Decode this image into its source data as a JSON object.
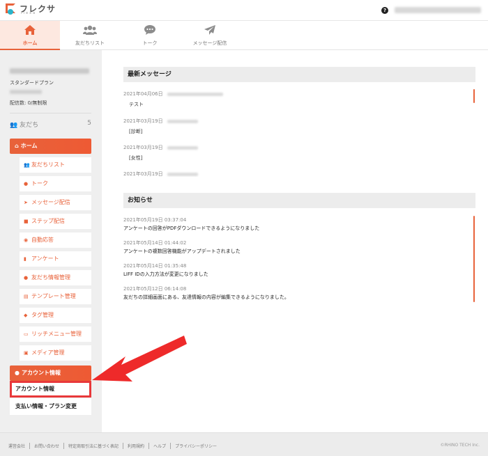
{
  "header": {
    "logo_text": "フレクサ",
    "logo_sub": "flexa",
    "help_icon": "?"
  },
  "nav": {
    "tabs": [
      {
        "label": "ホーム",
        "icon": "home-icon",
        "active": true
      },
      {
        "label": "友だちリスト",
        "icon": "users-icon",
        "active": false
      },
      {
        "label": "トーク",
        "icon": "chat-icon",
        "active": false
      },
      {
        "label": "メッセージ配信",
        "icon": "paper-plane-icon",
        "active": false
      }
    ]
  },
  "sidebar": {
    "plan": "スタンダードプラン",
    "delivery_count": "配信数: 0/無制限",
    "friends_label": "友だち",
    "friends_count": "5",
    "home_label": "ホーム",
    "items": [
      {
        "label": "友だちリスト",
        "icon": "users-icon"
      },
      {
        "label": "トーク",
        "icon": "chat-icon"
      },
      {
        "label": "メッセージ配信",
        "icon": "paper-plane-icon"
      },
      {
        "label": "ステップ配信",
        "icon": "book-icon"
      },
      {
        "label": "自動応答",
        "icon": "robot-icon"
      },
      {
        "label": "アンケート",
        "icon": "file-icon"
      },
      {
        "label": "友だち情報管理",
        "icon": "user-icon"
      },
      {
        "label": "テンプレート管理",
        "icon": "clipboard-icon"
      },
      {
        "label": "タグ管理",
        "icon": "tag-icon"
      },
      {
        "label": "リッチメニュー管理",
        "icon": "image-icon"
      },
      {
        "label": "メディア管理",
        "icon": "images-icon"
      }
    ],
    "account_head": "アカウント情報",
    "account_info": "アカウント情報",
    "billing": "支払い情報・プラン変更"
  },
  "latest_messages": {
    "title": "最新メッセージ",
    "items": [
      {
        "date": "2021年04月06日",
        "text": "テスト"
      },
      {
        "date": "2021年03月19日",
        "text": "[診断]"
      },
      {
        "date": "2021年03月19日",
        "text": "[女性]"
      },
      {
        "date": "2021年03月19日",
        "text": ""
      }
    ]
  },
  "news": {
    "title": "お知らせ",
    "items": [
      {
        "date": "2021年05月19日 03:37:04",
        "text": "アンケートの回答がPDFダウンロードできるようになりました"
      },
      {
        "date": "2021年05月14日 01:44:02",
        "text": "アンケートの複数回答機能がアップデートされました"
      },
      {
        "date": "2021年05月14日 01:35:48",
        "text": "LIFF IDの入力方法が変更になりました"
      },
      {
        "date": "2021年05月12日 06:14:08",
        "text": "友だちの詳細画面にある、友達情報の内容が編集できるようになりました。"
      }
    ]
  },
  "footer": {
    "links": [
      "運営会社",
      "お問い合わせ",
      "特定商取引法に基づく表記",
      "利用規約",
      "ヘルプ",
      "プライバシーポリシー"
    ],
    "copyright": "©RHINO TECH Inc."
  },
  "colors": {
    "accent": "#e8623a",
    "highlight": "#e8383a"
  }
}
